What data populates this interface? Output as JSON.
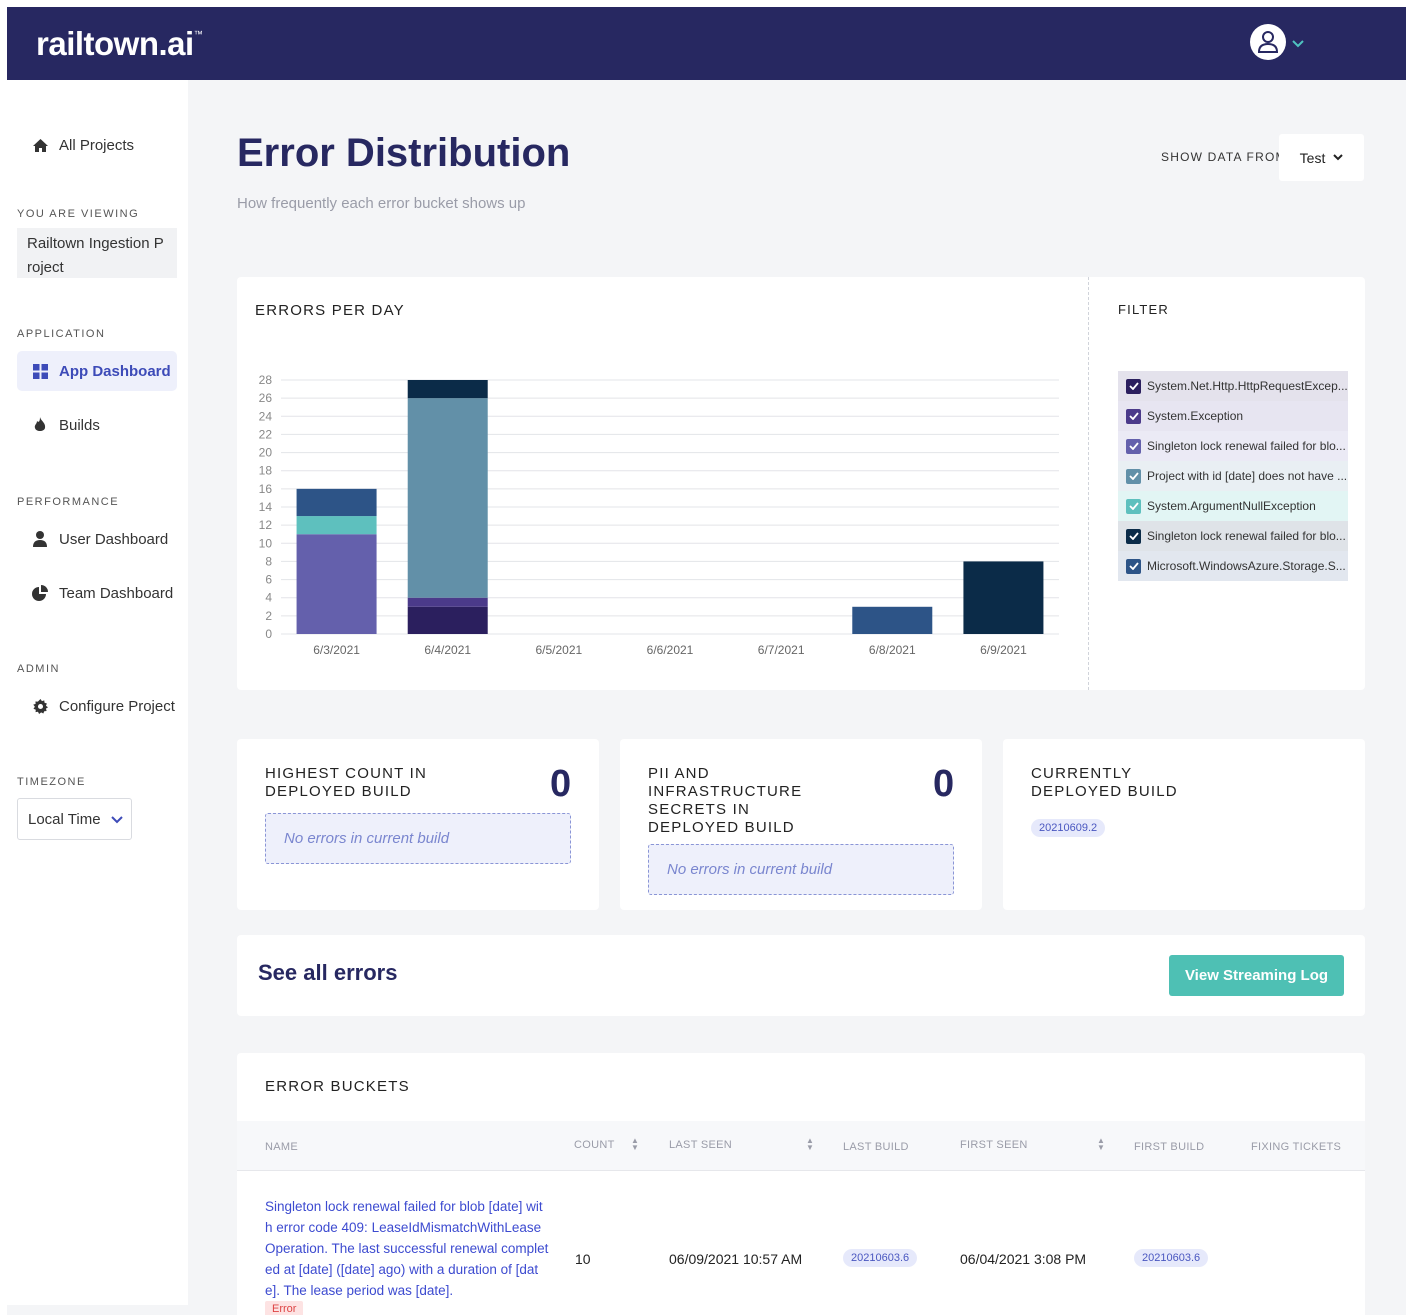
{
  "header": {
    "logo": "railtown.ai",
    "logo_tm": "™"
  },
  "sidebar": {
    "all_projects": "All Projects",
    "you_are_viewing": "YOU ARE VIEWING",
    "project_name": "Railtown Ingestion Project",
    "application": "APPLICATION",
    "app_dashboard": "App Dashboard",
    "builds": "Builds",
    "performance": "PERFORMANCE",
    "user_dashboard": "User Dashboard",
    "team_dashboard": "Team Dashboard",
    "admin": "ADMIN",
    "configure_project": "Configure Project",
    "timezone": "TIMEZONE",
    "timezone_value": "Local Time"
  },
  "page": {
    "title": "Error Distribution",
    "subtitle": "How frequently each error bucket shows up",
    "show_data_from": "SHOW DATA FROM:",
    "show_data_value": "Test"
  },
  "chart_card": {
    "heading": "ERRORS PER DAY",
    "filter_heading": "FILTER"
  },
  "filters": [
    {
      "label": "System.Net.Http.HttpRequestExcep...",
      "color": "#2b1f5e",
      "bg": "#e4e2ec"
    },
    {
      "label": "System.Exception",
      "color": "#4b3a8a",
      "bg": "#e7e5f1"
    },
    {
      "label": "Singleton lock renewal failed for blo...",
      "color": "#6460ac",
      "bg": "#ebeaf5"
    },
    {
      "label": "Project with id [date] does not have ...",
      "color": "#6290a8",
      "bg": "#e9eff3"
    },
    {
      "label": "System.ArgumentNullException",
      "color": "#5ec0be",
      "bg": "#e2f5f4"
    },
    {
      "label": "Singleton lock renewal failed for blo...",
      "color": "#0b2b48",
      "bg": "#dfe3e8"
    },
    {
      "label": "Microsoft.WindowsAzure.Storage.S...",
      "color": "#2d5487",
      "bg": "#e2e7ef"
    }
  ],
  "chart_data": {
    "type": "bar",
    "stacked": true,
    "categories": [
      "6/3/2021",
      "6/4/2021",
      "6/5/2021",
      "6/6/2021",
      "6/7/2021",
      "6/8/2021",
      "6/9/2021"
    ],
    "ylim": [
      0,
      28
    ],
    "yticks": [
      0,
      2,
      4,
      6,
      8,
      10,
      12,
      14,
      16,
      18,
      20,
      22,
      24,
      26,
      28
    ],
    "grid": true,
    "series": [
      {
        "color": "#2b1f5e",
        "values": [
          0,
          3,
          0,
          0,
          0,
          0,
          0
        ]
      },
      {
        "color": "#4b3a8a",
        "values": [
          0,
          1,
          0,
          0,
          0,
          0,
          0
        ]
      },
      {
        "color": "#6460ac",
        "values": [
          11,
          0,
          0,
          0,
          0,
          0,
          0
        ]
      },
      {
        "color": "#6290a8",
        "values": [
          0,
          22,
          0,
          0,
          0,
          0,
          0
        ]
      },
      {
        "color": "#5ec0be",
        "values": [
          2,
          0,
          0,
          0,
          0,
          0,
          0
        ]
      },
      {
        "color": "#0b2b48",
        "values": [
          0,
          2,
          0,
          0,
          0,
          0,
          8
        ]
      },
      {
        "color": "#2d5487",
        "values": [
          3,
          0,
          0,
          0,
          0,
          3,
          0
        ]
      }
    ]
  },
  "stats": {
    "highest_count_label": "HIGHEST COUNT IN DEPLOYED BUILD",
    "highest_count_value": "0",
    "highest_count_empty": "No errors in current build",
    "pii_label": "PII AND INFRASTRUCTURE SECRETS IN DEPLOYED BUILD",
    "pii_value": "0",
    "pii_empty": "No errors in current build",
    "deployed_label": "CURRENTLY DEPLOYED BUILD",
    "deployed_build": "20210609.2"
  },
  "see_all": {
    "title": "See all errors",
    "stream_button": "View Streaming Log"
  },
  "buckets": {
    "heading": "ERROR BUCKETS",
    "columns": {
      "name": "NAME",
      "count": "COUNT",
      "last_seen": "LAST SEEN",
      "last_build": "LAST BUILD",
      "first_seen": "FIRST SEEN",
      "first_build": "FIRST BUILD",
      "fixing_tickets": "FIXING TICKETS"
    },
    "rows": [
      {
        "name": "Singleton lock renewal failed for blob [date] with error code 409: LeaseIdMismatchWithLeaseOperation. The last successful renewal completed at [date] ([date] ago) with a duration of [date]. The lease period was [date].",
        "tag": "Error",
        "count": "10",
        "last_seen": "06/09/2021 10:57 AM",
        "last_build": "20210603.6",
        "first_seen": "06/04/2021 3:08 PM",
        "first_build": "20210603.6"
      }
    ]
  }
}
